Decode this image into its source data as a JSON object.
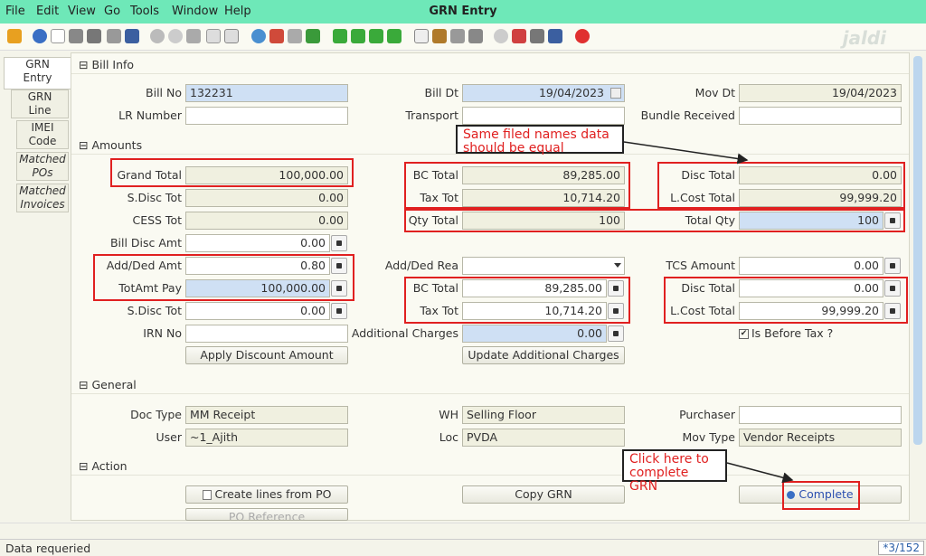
{
  "menu": {
    "file": "File",
    "edit": "Edit",
    "view": "View",
    "go": "Go",
    "tools": "Tools",
    "window": "Window",
    "help": "Help"
  },
  "window_title": "GRN Entry",
  "brand": "jaldi",
  "tabs": [
    {
      "label1": "GRN",
      "label2": "Entry"
    },
    {
      "label1": "GRN",
      "label2": "Line"
    },
    {
      "label1": "IMEI",
      "label2": "Code"
    },
    {
      "label1": "Matched",
      "label2": "POs"
    },
    {
      "label1": "Matched",
      "label2": "Invoices"
    }
  ],
  "sections": {
    "bill_info": "Bill Info",
    "amounts": "Amounts",
    "general": "General",
    "action": "Action"
  },
  "bill_info": {
    "bill_no_label": "Bill No",
    "bill_no": "132231",
    "bill_dt_label": "Bill Dt",
    "bill_dt": "19/04/2023",
    "mov_dt_label": "Mov Dt",
    "mov_dt": "19/04/2023",
    "lr_label": "LR Number",
    "lr": "",
    "transport_label": "Transport",
    "transport": "",
    "bundle_label": "Bundle Received",
    "bundle": ""
  },
  "amounts": {
    "grand_total_label": "Grand Total",
    "grand_total": "100,000.00",
    "bc_total_label": "BC Total",
    "bc_total": "89,285.00",
    "disc_total_label": "Disc Total",
    "disc_total": "0.00",
    "sdisc_tot_label": "S.Disc Tot",
    "sdisc_tot": "0.00",
    "tax_tot_label": "Tax Tot",
    "tax_tot": "10,714.20",
    "lcost_total_label": "L.Cost Total",
    "lcost_total": "99,999.20",
    "cess_tot_label": "CESS Tot",
    "cess_tot": "0.00",
    "qty_total_label": "Qty Total",
    "qty_total": "100",
    "total_qty_label": "Total Qty",
    "total_qty": "100",
    "bill_disc_label": "Bill Disc Amt",
    "bill_disc": "0.00",
    "add_ded_label": "Add/Ded Amt",
    "add_ded": "0.80",
    "add_ded_rea_label": "Add/Ded Rea",
    "add_ded_rea": "",
    "tcs_label": "TCS Amount",
    "tcs": "0.00",
    "totamt_pay_label": "TotAmt Pay",
    "totamt_pay": "100,000.00",
    "bc_total2_label": "BC Total",
    "bc_total2": "89,285.00",
    "disc_total2_label": "Disc Total",
    "disc_total2": "0.00",
    "sdisc_tot2_label": "S.Disc Tot",
    "sdisc_tot2": "0.00",
    "tax_tot2_label": "Tax Tot",
    "tax_tot2": "10,714.20",
    "lcost_total2_label": "L.Cost Total",
    "lcost_total2": "99,999.20",
    "irn_label": "IRN No",
    "irn": "",
    "additional_charges_label": "Additional Charges",
    "additional_charges": "0.00",
    "is_before_tax_label": "Is Before Tax ?",
    "apply_discount_button": "Apply Discount Amount",
    "update_charges_button": "Update Additional Charges"
  },
  "general": {
    "doc_type_label": "Doc Type",
    "doc_type": "MM Receipt",
    "wh_label": "WH",
    "wh": "Selling Floor",
    "purchaser_label": "Purchaser",
    "purchaser": "",
    "user_label": "User",
    "user": "~1_Ajith",
    "loc_label": "Loc",
    "loc": "PVDA",
    "mov_type_label": "Mov Type",
    "mov_type": "Vendor Receipts"
  },
  "action": {
    "create_lines_button": "Create lines from PO",
    "copy_grn_button": "Copy GRN",
    "complete_button": "Complete",
    "po_reference_button": "PO Reference"
  },
  "annotations": {
    "same_fields": "Same filed names data should be equal",
    "click_complete": "Click here to complete GRN"
  },
  "status": {
    "message": "Data requeried",
    "record": "*3/152"
  },
  "colors": {
    "menubar": "#6ee8b8",
    "highlight": "#e02020"
  }
}
